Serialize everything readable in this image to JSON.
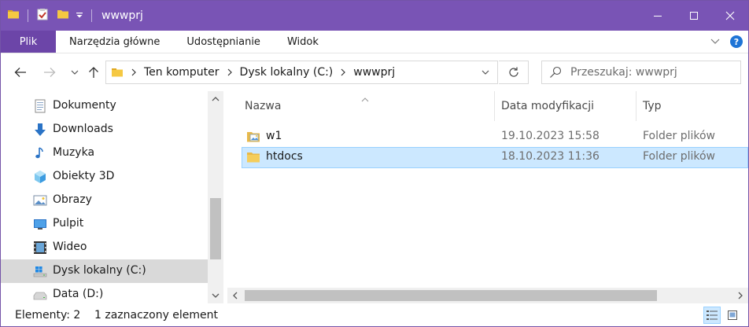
{
  "window": {
    "title": "wwwprj"
  },
  "ribbon": {
    "tabs": [
      {
        "label": "Plik"
      },
      {
        "label": "Narzędzia główne"
      },
      {
        "label": "Udostępnianie"
      },
      {
        "label": "Widok"
      }
    ]
  },
  "address": {
    "crumbs": [
      "Ten komputer",
      "Dysk lokalny (C:)",
      "wwwprj"
    ]
  },
  "search": {
    "placeholder": "Przeszukaj: wwwprj"
  },
  "nav": {
    "items": [
      {
        "label": "Dokumenty",
        "icon": "documents-icon"
      },
      {
        "label": "Downloads",
        "icon": "download-arrow-icon"
      },
      {
        "label": "Muzyka",
        "icon": "music-note-icon"
      },
      {
        "label": "Obiekty 3D",
        "icon": "cube-3d-icon"
      },
      {
        "label": "Obrazy",
        "icon": "pictures-icon"
      },
      {
        "label": "Pulpit",
        "icon": "desktop-icon"
      },
      {
        "label": "Wideo",
        "icon": "video-filmstrip-icon"
      },
      {
        "label": "Dysk lokalny (C:)",
        "icon": "windows-drive-icon",
        "selected": true
      },
      {
        "label": "Data (D:)",
        "icon": "drive-icon"
      }
    ]
  },
  "columns": {
    "name": "Nazwa",
    "modified": "Data modyfikacji",
    "type": "Typ"
  },
  "files": [
    {
      "name": "w1",
      "modified": "19.10.2023 15:58",
      "type": "Folder plików",
      "icon": "folder-with-image-icon"
    },
    {
      "name": "htdocs",
      "modified": "18.10.2023 11:36",
      "type": "Folder plików",
      "icon": "folder-icon",
      "selected": true
    }
  ],
  "status": {
    "count": "Elementy: 2",
    "selection": "1 zaznaczony element"
  },
  "colors": {
    "titlebar": "#7954b5",
    "file_tab": "#6c45a8",
    "selection": "#cce8ff",
    "folder": "#e8b94a"
  }
}
